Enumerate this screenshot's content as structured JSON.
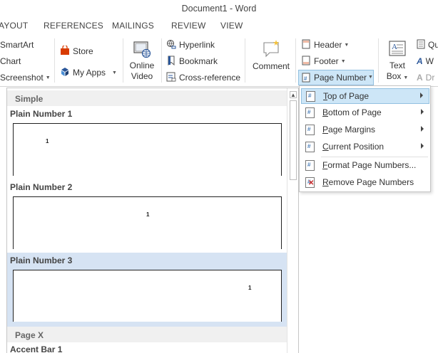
{
  "window": {
    "title": "Document1 - Word"
  },
  "tabs": [
    {
      "label": "AYOUT"
    },
    {
      "label": "REFERENCES"
    },
    {
      "label": "MAILINGS"
    },
    {
      "label": "REVIEW"
    },
    {
      "label": "VIEW"
    }
  ],
  "ribbon": {
    "illustrations": {
      "smartart": "SmartArt",
      "chart": "Chart",
      "screenshot": "Screenshot"
    },
    "addins": {
      "store": "Store",
      "my_apps": "My Apps"
    },
    "media": {
      "online_video_line1": "Online",
      "online_video_line2": "Video"
    },
    "links": {
      "hyperlink": "Hyperlink",
      "bookmark": "Bookmark",
      "cross_reference": "Cross-reference"
    },
    "comments": {
      "comment": "Comment"
    },
    "header_footer": {
      "header": "Header",
      "footer": "Footer",
      "page_number": "Page Number"
    },
    "text": {
      "text_box_line1": "Text",
      "text_box_line2": "Box",
      "quick_parts_partial": "Qu",
      "wordart_partial": "W",
      "dropcap_partial": "Dr"
    }
  },
  "gallery": {
    "sections": [
      {
        "label": "Simple"
      },
      {
        "label": "Page X"
      }
    ],
    "items": [
      {
        "label": "Plain Number 1",
        "sample": "1",
        "selected": false
      },
      {
        "label": "Plain Number 2",
        "sample": "1",
        "selected": false
      },
      {
        "label": "Plain Number 3",
        "sample": "1",
        "selected": true
      },
      {
        "label": "Accent Bar 1",
        "sample": "",
        "selected": false
      }
    ]
  },
  "page_number_menu": {
    "items": [
      {
        "label": "Top of Page",
        "has_submenu": true,
        "hovered": true
      },
      {
        "label": "Bottom of Page",
        "has_submenu": true,
        "hovered": false
      },
      {
        "label": "Page Margins",
        "has_submenu": true,
        "hovered": false
      },
      {
        "label": "Current Position",
        "has_submenu": true,
        "hovered": false
      },
      {
        "label": "Format Page Numbers...",
        "has_submenu": false,
        "hovered": false
      },
      {
        "label": "Remove Page Numbers",
        "has_submenu": false,
        "hovered": false
      }
    ]
  },
  "colors": {
    "accent_blue": "#2b579a",
    "hover_fill": "#cde6f7",
    "hover_border": "#92c0e0",
    "selected_fill": "#d6e3f3",
    "store_red": "#d83b01"
  }
}
